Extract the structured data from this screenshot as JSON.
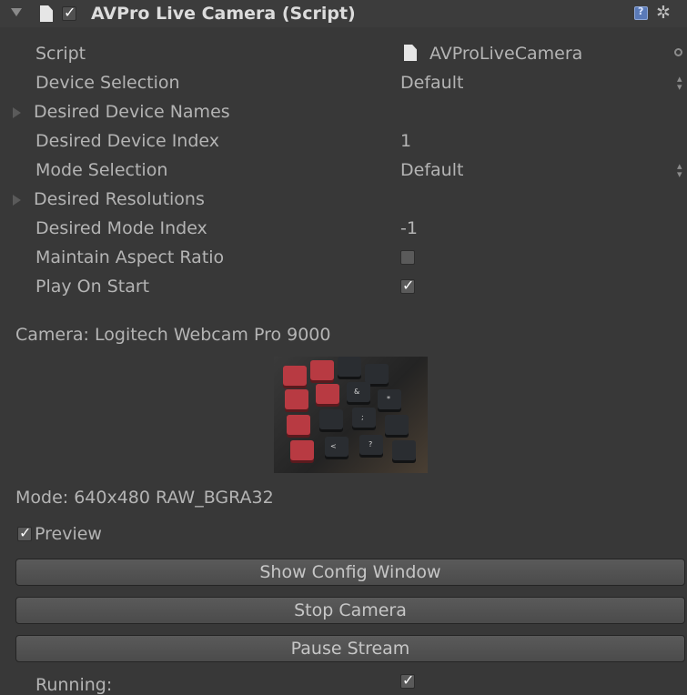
{
  "component": {
    "title": "AVPro Live Camera (Script)",
    "enabled": true,
    "help_icon": "help-book-icon",
    "settings_icon": "gear-icon"
  },
  "fields": {
    "script": {
      "label": "Script",
      "value": "AVProLiveCamera"
    },
    "device_selection": {
      "label": "Device Selection",
      "value": "Default"
    },
    "desired_device_names": {
      "label": "Desired Device Names"
    },
    "desired_device_index": {
      "label": "Desired Device Index",
      "value": "1"
    },
    "mode_selection": {
      "label": "Mode Selection",
      "value": "Default"
    },
    "desired_resolutions": {
      "label": "Desired Resolutions"
    },
    "desired_mode_index": {
      "label": "Desired Mode Index",
      "value": "-1"
    },
    "maintain_aspect_ratio": {
      "label": "Maintain Aspect Ratio",
      "checked": false
    },
    "play_on_start": {
      "label": "Play On Start",
      "checked": true
    }
  },
  "camera_info": "Camera: Logitech Webcam Pro 9000",
  "mode_info": "Mode: 640x480 RAW_BGRA32",
  "preview": {
    "label": "Preview",
    "checked": true
  },
  "buttons": {
    "show_config": "Show Config Window",
    "stop_camera": "Stop Camera",
    "pause_stream": "Pause Stream"
  },
  "running": {
    "label": "Running:",
    "checked": true
  }
}
